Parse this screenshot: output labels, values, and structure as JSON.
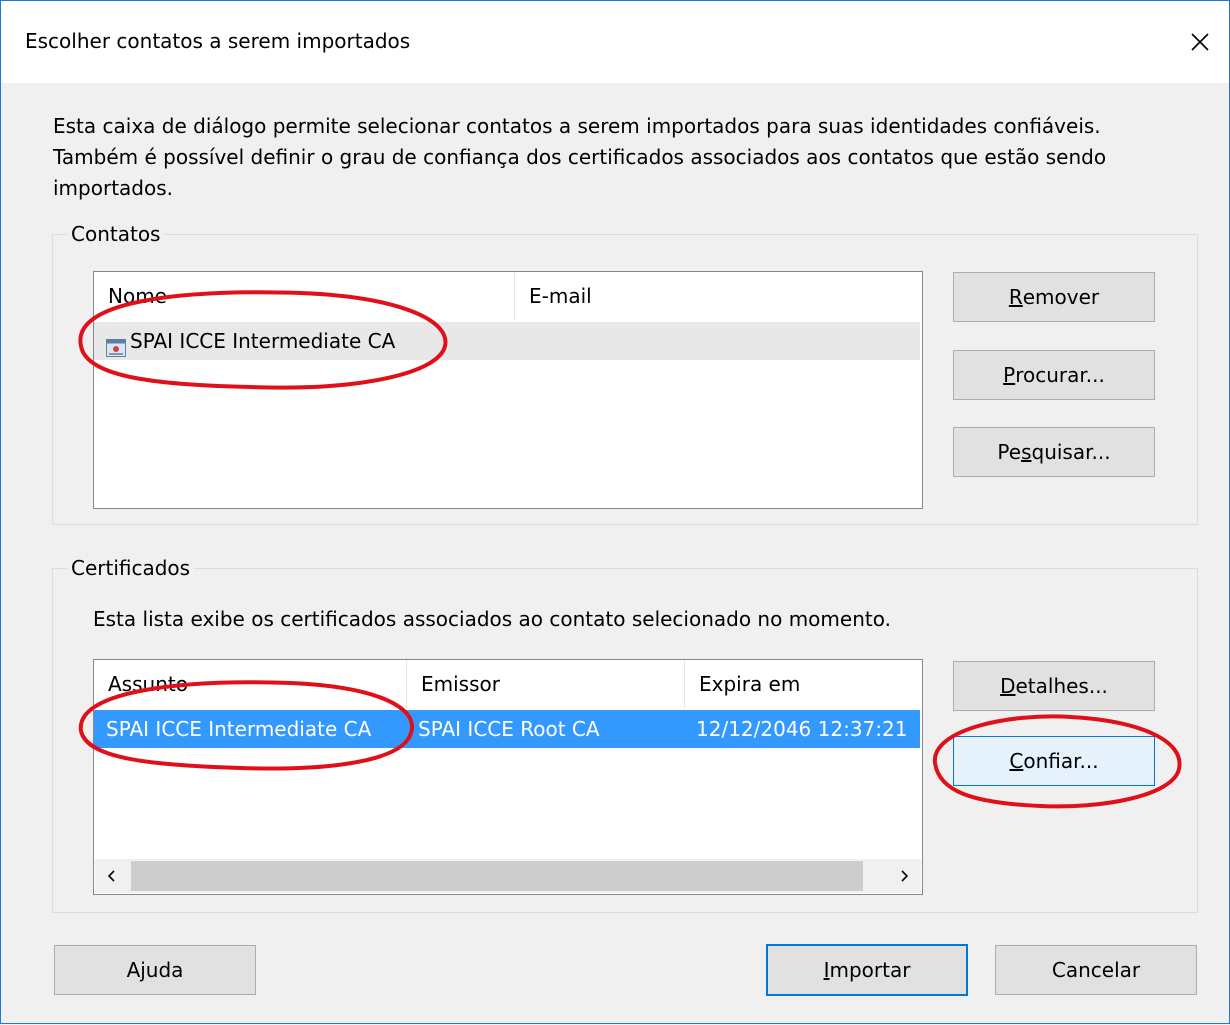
{
  "window": {
    "title": "Escolher contatos a serem importados"
  },
  "intro_lines": [
    "Esta caixa de diálogo permite selecionar contatos a serem importados para suas identidades confiáveis.",
    "Também é possível definir o grau de confiança dos certificados associados aos contatos que estão sendo",
    "importados."
  ],
  "contacts": {
    "group_label": "Contatos",
    "columns": [
      "Nome",
      "E-mail"
    ],
    "rows": [
      {
        "name": "SPAI ICCE Intermediate CA",
        "email": ""
      }
    ],
    "buttons": {
      "remove": {
        "mn": "R",
        "rest": "emover"
      },
      "browse": {
        "mn": "P",
        "rest": "rocurar..."
      },
      "search": {
        "pre": "Pe",
        "mn": "s",
        "rest": "quisar..."
      }
    }
  },
  "certificates": {
    "group_label": "Certificados",
    "description": "Esta lista exibe os certificados associados ao contato selecionado no momento.",
    "columns": [
      "Assunto",
      "Emissor",
      "Expira em"
    ],
    "rows": [
      {
        "subject": "SPAI ICCE Intermediate CA",
        "issuer": "SPAI ICCE Root CA",
        "expires": "12/12/2046 12:37:21"
      }
    ],
    "buttons": {
      "details": {
        "mn": "D",
        "rest": "etalhes..."
      },
      "trust": {
        "mn": "C",
        "rest": "onfiar..."
      }
    }
  },
  "footer": {
    "help": "Ajuda",
    "import": {
      "mn": "I",
      "rest": "mportar"
    },
    "cancel": "Cancelar"
  },
  "colors": {
    "accent": "#0078d7",
    "selection": "#3399ff",
    "annotation": "#e0101a"
  }
}
